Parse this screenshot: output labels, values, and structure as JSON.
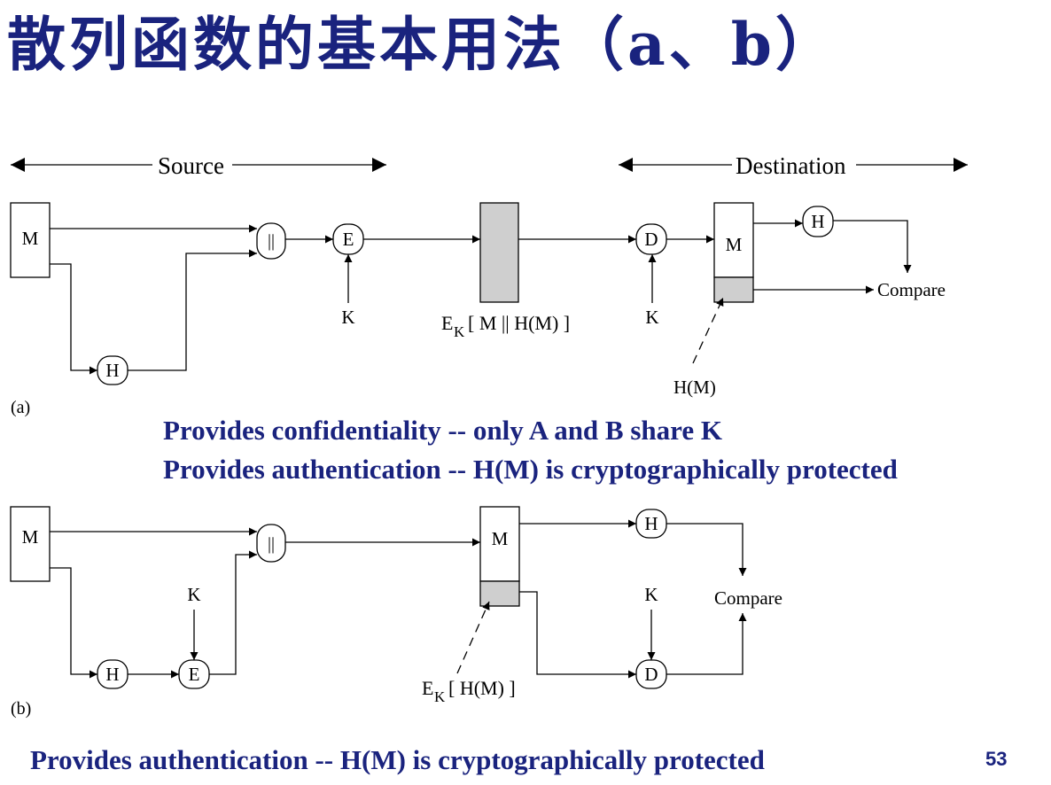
{
  "slide": {
    "title": "散列函数的基本用法（a、b）",
    "page_number": "53"
  },
  "diagram_a": {
    "label": "(a)",
    "source_label": "Source",
    "destination_label": "Destination",
    "message": "M",
    "hash": "H",
    "concat": "||",
    "encrypt": "E",
    "decrypt": "D",
    "key": "K",
    "cipher_label_prefix": "E",
    "cipher_label_sub": "K",
    "cipher_label_body": "[ M || H(M) ]",
    "received_message": "M",
    "received_hash_label": "H(M)",
    "compare": "Compare",
    "captions": [
      "Provides confidentiality  -- only A and B share K",
      "Provides authentication  -- H(M) is cryptographically protected"
    ]
  },
  "diagram_b": {
    "label": "(b)",
    "message": "M",
    "hash": "H",
    "encrypt": "E",
    "key": "K",
    "concat": "||",
    "received_message": "M",
    "dest_hash": "H",
    "decrypt": "D",
    "dest_key": "K",
    "compare": "Compare",
    "enc_hash_prefix": "E",
    "enc_hash_sub": "K",
    "enc_hash_body": "[ H(M) ]",
    "caption": "Provides authentication  -- H(M) is cryptographically protected"
  }
}
